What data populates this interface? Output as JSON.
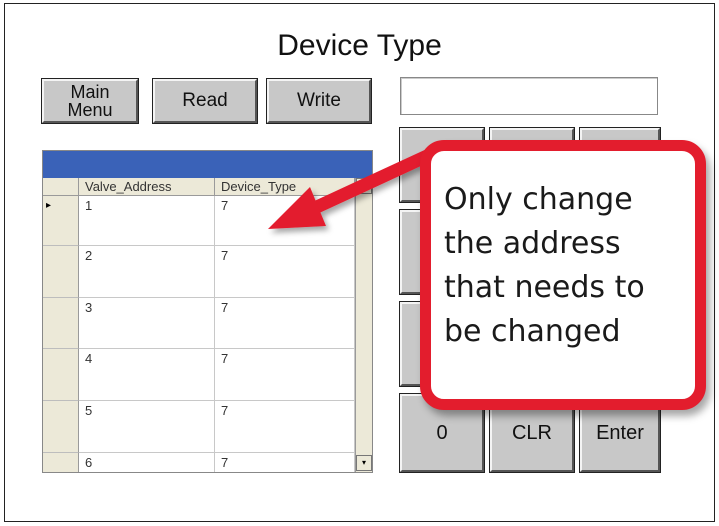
{
  "screen": {
    "title": "Device Type"
  },
  "toolbar": {
    "main_menu_line1": "Main",
    "main_menu_line2": "Menu",
    "read_label": "Read",
    "write_label": "Write"
  },
  "entry": {
    "value": ""
  },
  "keypad": {
    "keys": [
      "0",
      "CLR",
      "Enter"
    ]
  },
  "grid": {
    "columns": [
      "Valve_Address",
      "Device_Type"
    ],
    "rows": [
      {
        "indicator": "▸",
        "valve_address": "1",
        "device_type": "7"
      },
      {
        "indicator": "",
        "valve_address": "2",
        "device_type": "7"
      },
      {
        "indicator": "",
        "valve_address": "3",
        "device_type": "7"
      },
      {
        "indicator": "",
        "valve_address": "4",
        "device_type": "7"
      },
      {
        "indicator": "",
        "valve_address": "5",
        "device_type": "7"
      },
      {
        "indicator": "",
        "valve_address": "6",
        "device_type": "7"
      }
    ],
    "scroll_up_icon": "▴",
    "scroll_down_icon": "▾"
  },
  "callout": {
    "line1": "Only change",
    "line2": "the address",
    "line3": "that needs to",
    "line4": "be changed",
    "border_color": "#e31d2d"
  }
}
